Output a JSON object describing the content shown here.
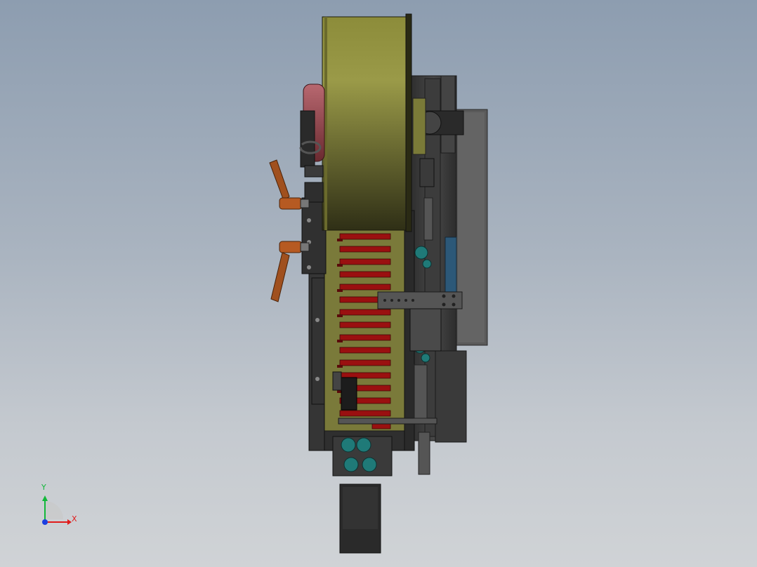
{
  "triad": {
    "x_label": "X",
    "y_label": "Y",
    "colors": {
      "x": "#e01b1b",
      "y": "#12b83a",
      "z": "#1b3fe0"
    }
  },
  "colors": {
    "background_top": "#8d9db0",
    "background_bottom": "#d0d3d6",
    "drum": "#8f8f3a",
    "plate": "#3a3a3a",
    "blade": "#9a1010",
    "handle": "#a0501e",
    "roller": "#a85058",
    "fitting": "#1f7a78"
  }
}
